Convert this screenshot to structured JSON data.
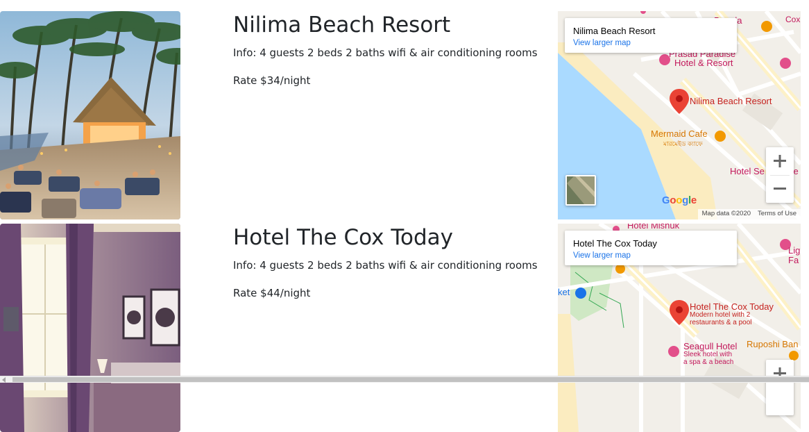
{
  "listings": [
    {
      "name": "Nilima Beach Resort",
      "info": "Info: 4 guests 2 beds 2 baths wifi & air conditioning rooms",
      "rate": "Rate $34/night",
      "map": {
        "card_title": "Nilima Beach Resort",
        "card_link": "View larger map",
        "marker_label": "Nilima Beach Resort",
        "places": {
          "hotel_resort": "Hotel & Resort",
          "paradise": "Prasad Paradise",
          "mermaid": "Mermaid Cafe",
          "mermaid_bn": "মারমেইড ক্যাফে",
          "hotel_sea": "Hotel Se",
          "hotel_sea_tail": "ce",
          "bangla": "Bangla",
          "cox": "Cox"
        },
        "attribution_data": "Map data ©2020",
        "attribution_terms": "Terms of Use",
        "logo": "Google",
        "zoom_in_icon": "plus-icon",
        "zoom_out_icon": "minus-icon"
      }
    },
    {
      "name": "Hotel The Cox Today",
      "info": "Info: 4 guests 2 beds 2 baths wifi & air conditioning rooms",
      "rate": "Rate $44/night",
      "map": {
        "card_title": "Hotel The Cox Today",
        "card_link": "View larger map",
        "marker_label": "Hotel The Cox Today",
        "marker_sub1": "Modern hotel with 2",
        "marker_sub2": "restaurants & a pool",
        "places": {
          "mishuk": "Hotel Mishuk",
          "seagull": "Seagull Hotel",
          "seagull_sub1": "Sleek hotel with",
          "seagull_sub2": "a spa & a beach",
          "ruposhi": "Ruposhi Ban",
          "lig": "Lig",
          "fa": "Fa",
          "ket": "ket"
        },
        "zoom_in_icon": "plus-icon"
      }
    }
  ],
  "colors": {
    "text": "#212529",
    "link": "#1a73e8",
    "marker": "#ea4335",
    "water": "#aadaff",
    "sand": "#fbecc0"
  }
}
